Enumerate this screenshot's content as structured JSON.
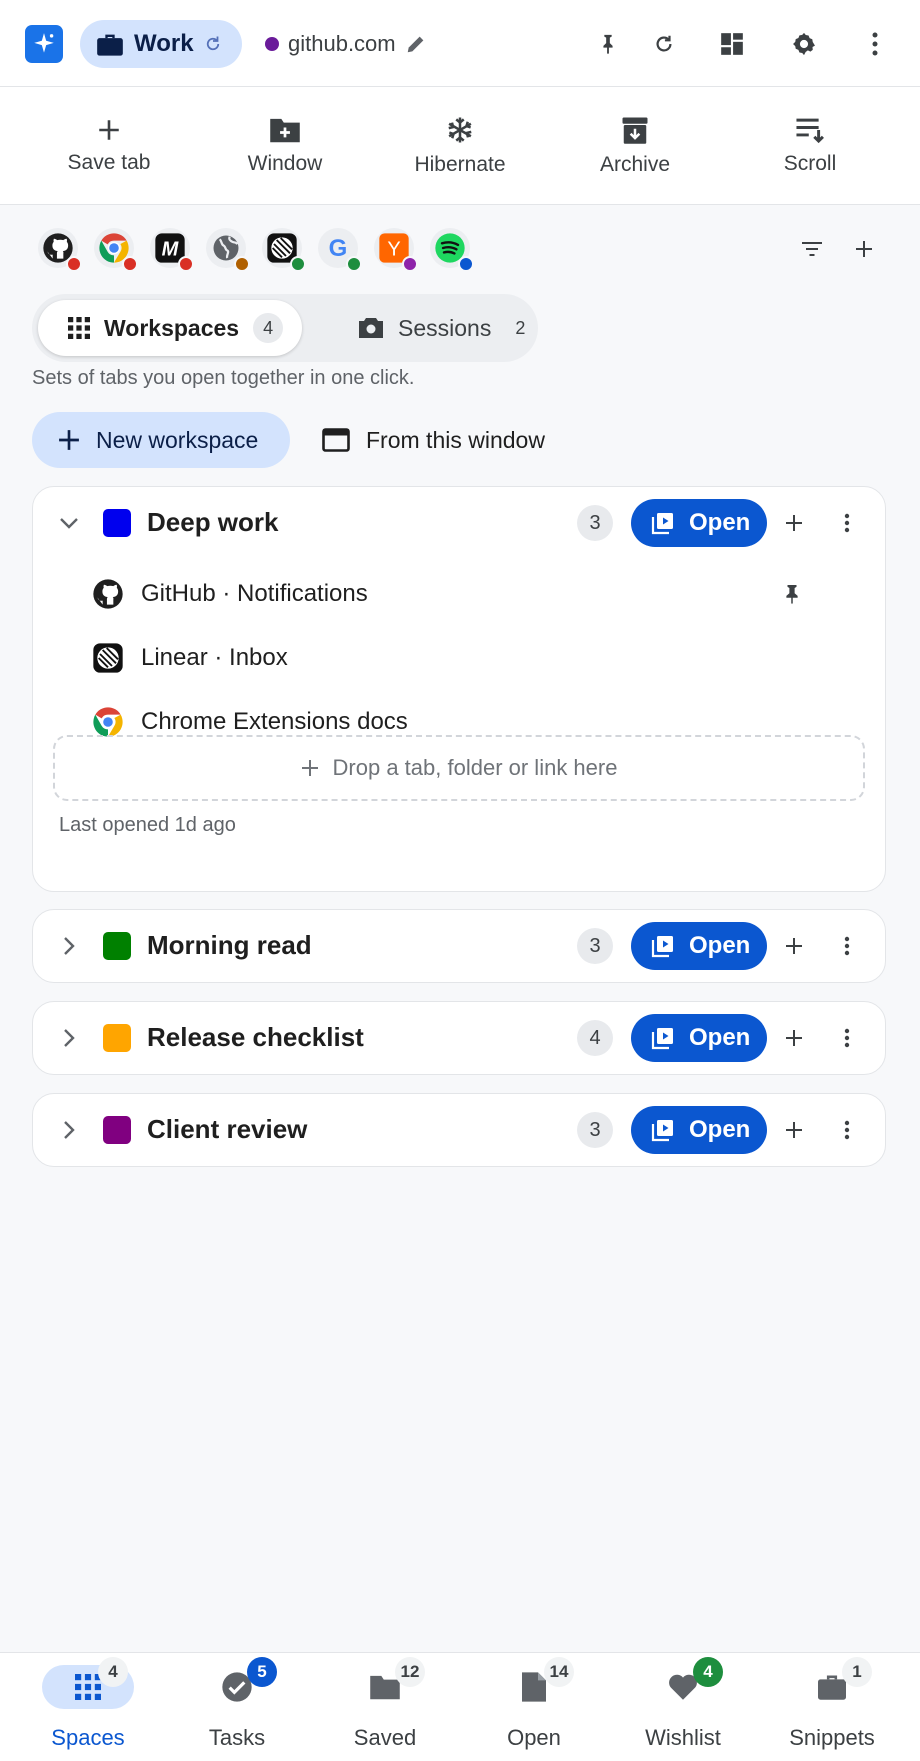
{
  "header": {
    "profile": {
      "name": "Work",
      "chip_color": "#d3e3fd"
    },
    "site": {
      "domain": "github.com",
      "dot_color": "#6a1b9a"
    },
    "icons": [
      "sparkle-logo-icon",
      "briefcase-icon",
      "sync-icon",
      "edit-pencil-icon",
      "pin-icon",
      "reload-icon",
      "dashboard-icon",
      "settings-icon",
      "more-vert-icon"
    ]
  },
  "toolbar": {
    "items": [
      {
        "label": "Save tab",
        "icon": "plus-icon"
      },
      {
        "label": "Window",
        "icon": "folder-add-icon"
      },
      {
        "label": "Hibernate",
        "icon": "snowflake-icon"
      },
      {
        "label": "Archive",
        "icon": "archive-icon"
      },
      {
        "label": "Scroll",
        "icon": "sort-list-icon"
      }
    ]
  },
  "favicons": [
    {
      "site": "github",
      "badge_color": "#d93025"
    },
    {
      "site": "chrome",
      "badge_color": "#d93025"
    },
    {
      "site": "medium",
      "badge_color": "#d93025"
    },
    {
      "site": "globe",
      "badge_color": "#b06000"
    },
    {
      "site": "linear",
      "badge_color": "#1e8e3e"
    },
    {
      "site": "google",
      "badge_color": "#1e8e3e"
    },
    {
      "site": "ycombinator",
      "badge_color": "#8e24aa"
    },
    {
      "site": "spotify",
      "badge_color": "#0b57d0"
    }
  ],
  "favicon_labels": {
    "medium": "M",
    "ycombinator": "Y",
    "google": "G"
  },
  "segments": {
    "workspaces": {
      "label": "Workspaces",
      "count": "4"
    },
    "sessions": {
      "label": "Sessions",
      "count": "2"
    }
  },
  "helper_text": "Sets of tabs you open together in one click.",
  "actions": {
    "new_workspace": "New workspace",
    "from_window": "From this window"
  },
  "workspaces": [
    {
      "name": "Deep work",
      "color": "#0000ee",
      "count": "3",
      "expanded": true,
      "open_label": "Open",
      "tabs": [
        {
          "title": "GitHub · Notifications",
          "icon": "github-icon",
          "pinned": true
        },
        {
          "title": "Linear · Inbox",
          "icon": "linear-icon",
          "pinned": false
        },
        {
          "title": "Chrome Extensions docs",
          "icon": "chrome-icon",
          "pinned": false
        }
      ],
      "dropzone": "Drop a tab, folder or link here",
      "last_opened": "Last opened 1d ago"
    },
    {
      "name": "Morning read",
      "color": "#008000",
      "count": "3",
      "expanded": false,
      "open_label": "Open"
    },
    {
      "name": "Release checklist",
      "color": "#ffa500",
      "count": "4",
      "expanded": false,
      "open_label": "Open"
    },
    {
      "name": "Client review",
      "color": "#800080",
      "count": "3",
      "expanded": false,
      "open_label": "Open"
    }
  ],
  "bottom_nav": [
    {
      "label": "Spaces",
      "badge": "4",
      "badge_style": "neutral",
      "active": true,
      "icon": "grid-icon"
    },
    {
      "label": "Tasks",
      "badge": "5",
      "badge_style": "blue",
      "active": false,
      "icon": "check-circle-icon"
    },
    {
      "label": "Saved",
      "badge": "12",
      "badge_style": "neutral",
      "active": false,
      "icon": "folder-icon"
    },
    {
      "label": "Open",
      "badge": "14",
      "badge_style": "neutral",
      "active": false,
      "icon": "file-icon"
    },
    {
      "label": "Wishlist",
      "badge": "4",
      "badge_style": "green",
      "active": false,
      "icon": "heart-icon"
    },
    {
      "label": "Snippets",
      "badge": "1",
      "badge_style": "neutral",
      "active": false,
      "icon": "briefcase-icon"
    }
  ],
  "colors": {
    "primary": "#0b57d0",
    "primary_soft": "#d3e3fd",
    "badge_blue": "#0b57d0",
    "badge_green": "#1e8e3e"
  }
}
